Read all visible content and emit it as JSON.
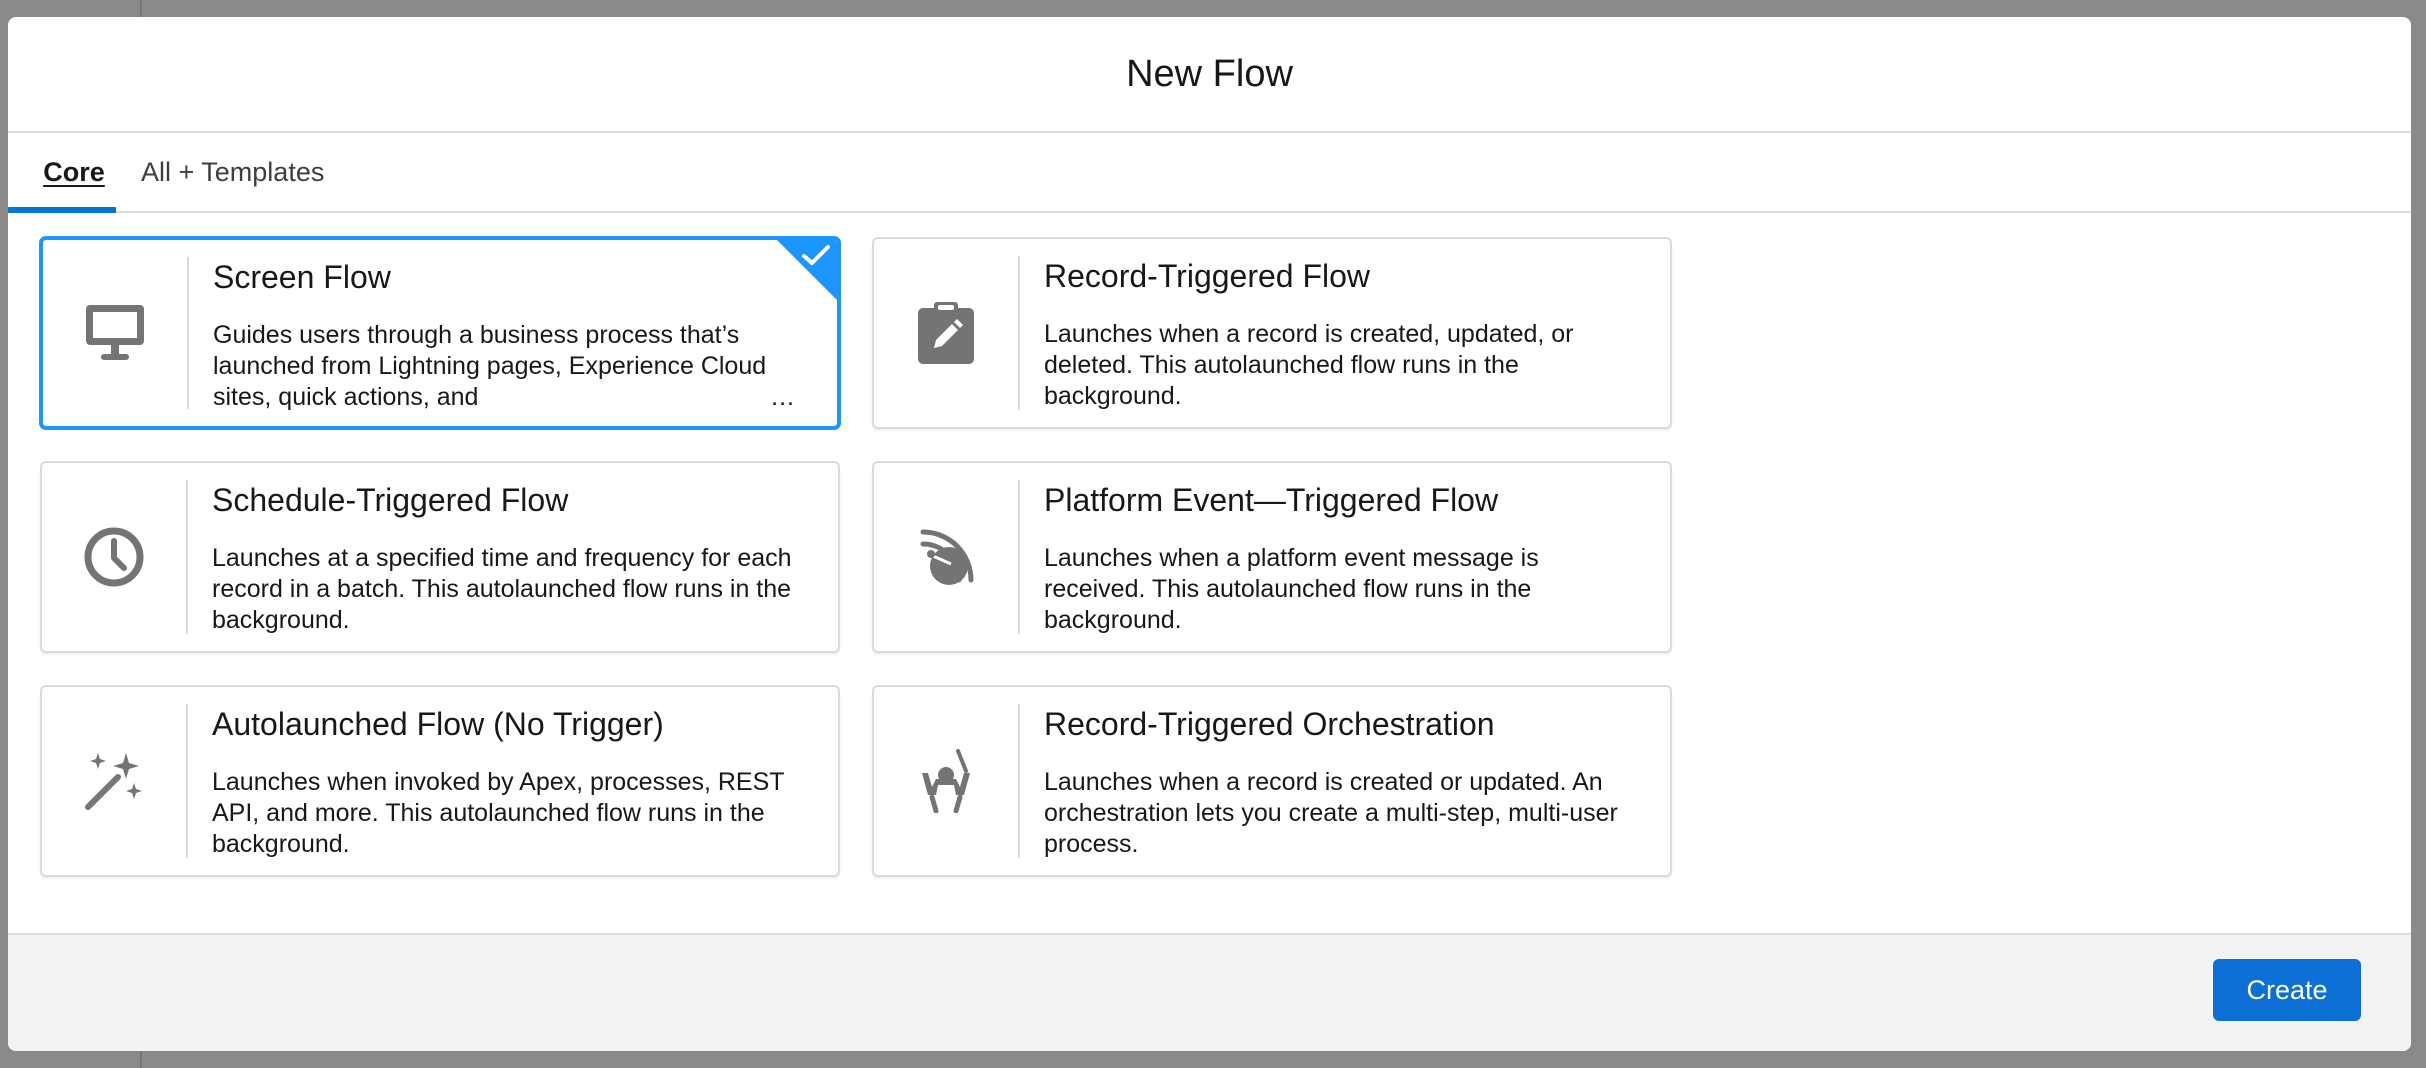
{
  "modal": {
    "title": "New Flow",
    "tabs": [
      {
        "label": "Core",
        "active": true
      },
      {
        "label": "All + Templates",
        "active": false
      }
    ],
    "cards": [
      {
        "title": "Screen Flow",
        "description": "Guides users through a business process that’s launched from Lightning pages, Experience Cloud sites, quick actions, and",
        "ellipsis": "...",
        "icon": "desktop-icon",
        "selected": true
      },
      {
        "title": "Record-Triggered Flow",
        "description": "Launches when a record is created, updated, or deleted. This autolaunched flow runs in the background.",
        "icon": "clipboard-edit-icon",
        "selected": false
      },
      {
        "title": "Schedule-Triggered Flow",
        "description": "Launches at a specified time and frequency for each record in a batch. This autolaunched flow runs in the background.",
        "icon": "clock-icon",
        "selected": false
      },
      {
        "title": "Platform Event—Triggered Flow",
        "description": "Launches when a platform event message is received. This autolaunched flow runs in the background.",
        "icon": "satellite-dish-icon",
        "selected": false
      },
      {
        "title": "Autolaunched Flow (No Trigger)",
        "description": "Launches when invoked by Apex, processes, REST API, and more. This autolaunched flow runs in the background.",
        "icon": "magic-wand-icon",
        "selected": false
      },
      {
        "title": "Record-Triggered Orchestration",
        "description": "Launches when a record is created or updated. An orchestration lets you create a multi-step, multi-user process.",
        "icon": "conductor-icon",
        "selected": false
      }
    ]
  },
  "footer": {
    "create_label": "Create"
  },
  "colors": {
    "brand": "#0b6fd6",
    "selected_border": "#1b96ff",
    "icon": "#747474"
  }
}
